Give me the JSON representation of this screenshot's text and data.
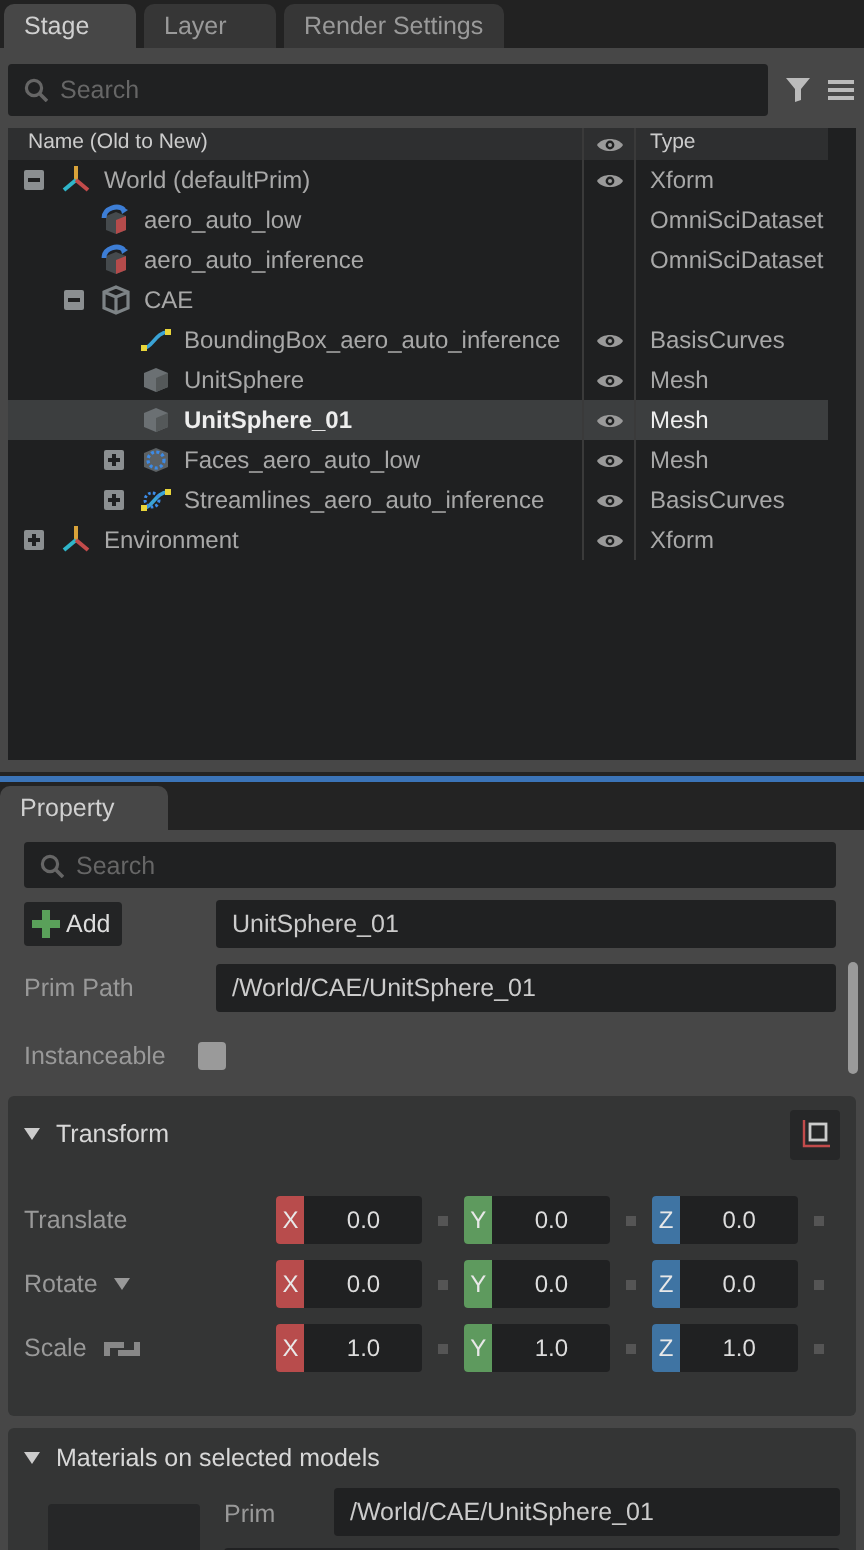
{
  "stage_tabs": [
    {
      "label": "Stage",
      "selected": true
    },
    {
      "label": "Layer",
      "selected": false
    },
    {
      "label": "Render Settings",
      "selected": false
    }
  ],
  "stage_search": {
    "placeholder": "Search"
  },
  "tree_columns": {
    "name": "Name (Old to New)",
    "type": "Type"
  },
  "tree": [
    {
      "name": "World (defaultPrim)",
      "kind": "xform",
      "type": "Xform",
      "visible": true,
      "selected": false,
      "expanded": true,
      "children": [
        {
          "name": "aero_auto_low",
          "kind": "dataset",
          "type": "OmniSciDataset",
          "visible": false,
          "selected": false
        },
        {
          "name": "aero_auto_inference",
          "kind": "dataset",
          "type": "OmniSciDataset",
          "visible": false,
          "selected": false
        },
        {
          "name": "CAE",
          "kind": "scope",
          "visible": false,
          "selected": false,
          "expanded": true,
          "children": [
            {
              "name": "BoundingBox_aero_auto_inference",
              "kind": "curves",
              "type": "BasisCurves",
              "visible": true,
              "selected": false
            },
            {
              "name": "UnitSphere",
              "kind": "mesh",
              "type": "Mesh",
              "visible": true,
              "selected": false
            },
            {
              "name": "UnitSphere_01",
              "kind": "mesh",
              "type": "Mesh",
              "visible": true,
              "selected": true
            },
            {
              "name": "Faces_aero_auto_low",
              "kind": "faces",
              "type": "Mesh",
              "visible": true,
              "selected": false,
              "expanded": false
            },
            {
              "name": "Streamlines_aero_auto_inference",
              "kind": "streamlines",
              "type": "BasisCurves",
              "visible": true,
              "selected": false,
              "expanded": false
            }
          ]
        }
      ]
    },
    {
      "name": "Environment",
      "kind": "xform",
      "type": "Xform",
      "visible": true,
      "selected": false,
      "expanded": false
    }
  ],
  "property_tab": {
    "label": "Property",
    "selected": true
  },
  "property_search": {
    "placeholder": "Search"
  },
  "add_button": "Add",
  "prim_name": "UnitSphere_01",
  "prim_path": {
    "label": "Prim Path",
    "value": "/World/CAE/UnitSphere_01"
  },
  "instanceable": {
    "label": "Instanceable",
    "checked": false
  },
  "transform": {
    "title": "Transform",
    "expanded": true,
    "rows": [
      {
        "label": "Translate",
        "kind": "plain",
        "fields": [
          {
            "axis": "X",
            "value": "0.0"
          },
          {
            "axis": "Y",
            "value": "0.0"
          },
          {
            "axis": "Z",
            "value": "0.0"
          }
        ]
      },
      {
        "label": "Rotate",
        "kind": "dropdown",
        "fields": [
          {
            "axis": "X",
            "value": "0.0"
          },
          {
            "axis": "Y",
            "value": "0.0"
          },
          {
            "axis": "Z",
            "value": "0.0"
          }
        ]
      },
      {
        "label": "Scale",
        "kind": "linked",
        "fields": [
          {
            "axis": "X",
            "value": "1.0"
          },
          {
            "axis": "Y",
            "value": "1.0"
          },
          {
            "axis": "Z",
            "value": "1.0"
          }
        ]
      }
    ]
  },
  "materials": {
    "title": "Materials on selected models",
    "expanded": true,
    "prim_label": "Prim",
    "prim_value": "/World/CAE/UnitSphere_01"
  }
}
